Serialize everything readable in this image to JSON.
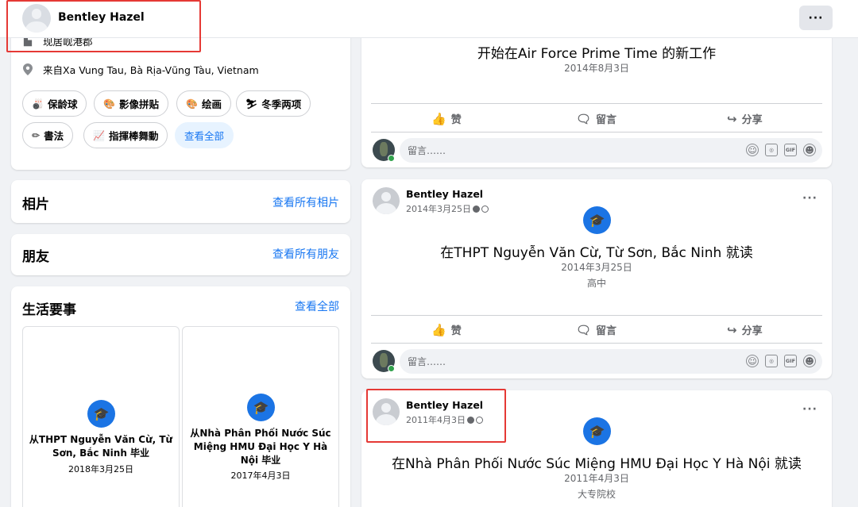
{
  "header": {
    "name": "Bentley Hazel",
    "more_label": "···"
  },
  "intro": {
    "lives_in": "现居岘港郡",
    "from": "来自Xa Vung Tau, Bà Rịa-Vũng Tàu, Vietnam",
    "hobbies": [
      "保龄球",
      "影像拼贴",
      "绘画",
      "冬季两项",
      "書法",
      "指揮棒舞動"
    ],
    "see_all": "查看全部"
  },
  "photos": {
    "title": "相片",
    "link": "查看所有相片"
  },
  "friends": {
    "title": "朋友",
    "link": "查看所有朋友"
  },
  "life_events": {
    "title": "生活要事",
    "link": "查看全部",
    "tiles": [
      {
        "text": "从THPT Nguyễn Văn Cừ, Từ Sơn, Bắc Ninh 毕业",
        "date": "2018年3月25日"
      },
      {
        "text": "从Nhà Phân Phối Nước Súc Miệng HMU Đại Học Y Hà Nội 毕业",
        "date": "2017年4月3日"
      }
    ]
  },
  "posts": [
    {
      "headline": "开始在Air Force Prime Time 的新工作",
      "date_line": "2014年8月3日"
    },
    {
      "author": "Bentley Hazel",
      "meta_date": "2014年3月25日",
      "headline": "在THPT Nguyễn Văn Cừ, Từ Sơn, Bắc Ninh 就读",
      "date_line": "2014年3月25日",
      "detail": "高中"
    },
    {
      "author": "Bentley Hazel",
      "meta_date": "2011年4月3日",
      "headline": "在Nhà Phân Phối Nước Súc Miệng HMU Đại Học Y Hà Nội 就读",
      "date_line": "2011年4月3日",
      "detail": "大专院校"
    }
  ],
  "actions": {
    "like": "赞",
    "comment": "留言",
    "share": "分享"
  },
  "comment_placeholder": "留言……",
  "colors": {
    "accent": "#1877f2",
    "highlight_box": "#e53935",
    "online": "#31a24c"
  }
}
